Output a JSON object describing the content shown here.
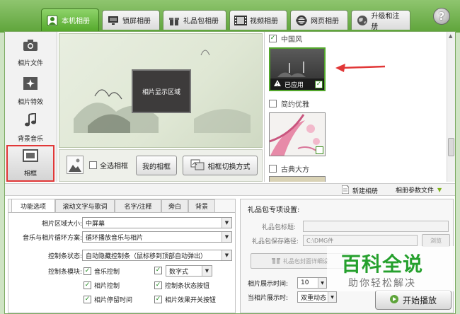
{
  "tabs": [
    {
      "label": "本机相册",
      "icon": "local-album-icon",
      "active": true
    },
    {
      "label": "锁屏相册",
      "icon": "monitor-icon",
      "active": false
    },
    {
      "label": "礼品包相册",
      "icon": "gift-icon",
      "active": false
    },
    {
      "label": "视频相册",
      "icon": "film-icon",
      "active": false
    },
    {
      "label": "网页相册",
      "icon": "ie-icon",
      "active": false
    },
    {
      "label": "升级和注册",
      "icon": "globe-icon",
      "active": false
    }
  ],
  "help": {
    "label": "?"
  },
  "sidebar": {
    "items": [
      {
        "label": "相片文件",
        "icon": "camera-icon"
      },
      {
        "label": "相片特效",
        "icon": "effects-icon"
      },
      {
        "label": "背景音乐",
        "icon": "music-icon"
      },
      {
        "label": "相框",
        "icon": "frame-icon",
        "active": true
      }
    ]
  },
  "preview": {
    "screen_label": "相片显示区域"
  },
  "preview_tools": {
    "select_all": "全选相框",
    "my_frames": "我的相框",
    "switch_mode": "相框切换方式"
  },
  "frames": {
    "groups": [
      {
        "name": "中国风",
        "checked": true
      },
      {
        "name": "简约优雅",
        "checked": false
      },
      {
        "name": "古典大方",
        "checked": false
      }
    ],
    "applied_label": "已应用"
  },
  "midbar": {
    "new_album": "新建相册",
    "album_params": "相册参数文件"
  },
  "lower_tabs": [
    {
      "label": "功能选项",
      "active": true
    },
    {
      "label": "滚动文字与歌词"
    },
    {
      "label": "名字/注释"
    },
    {
      "label": "旁白"
    },
    {
      "label": "背景"
    }
  ],
  "options": {
    "area_size_label": "相片区域大小:",
    "area_size_value": "中屏幕",
    "loop_label": "音乐与相片循环方案:",
    "loop_value": "循环播放音乐与相片",
    "control_bar_label": "控制条状态:",
    "control_bar_value": "自动隐藏控制条（鼠标移到顶部自动弹出）",
    "modules_label": "控制条模块:",
    "modules": [
      {
        "label": "音乐控制",
        "checked": true
      },
      {
        "label": "数字式",
        "checked": true,
        "dropdown": true
      },
      {
        "label": "相片控制",
        "checked": true
      },
      {
        "label": "控制条状态按钮",
        "checked": true
      },
      {
        "label": "相片停留时间",
        "checked": true
      },
      {
        "label": "相片效果开关按钮",
        "checked": true
      }
    ]
  },
  "gift": {
    "title": "礼品包专项设置:",
    "title_field_label": "礼品包标题:",
    "path_label": "礼品包保存路径:",
    "path_value": "C:\\DMG件",
    "browse_label": "浏览",
    "cover_button": "礼品包封面详细设",
    "display_time_label": "相片展示时间:",
    "display_time_value": "10",
    "current_display_label": "当相片展示时:",
    "current_display_value": "双重动态",
    "play_button": "开始播放"
  },
  "watermark": {
    "title": "百科全说",
    "subtitle": "助你轻松解决"
  },
  "colors": {
    "accent_green": "#5ea43a",
    "arrow_red": "#e13737",
    "watermark_green": "#25a02d"
  }
}
